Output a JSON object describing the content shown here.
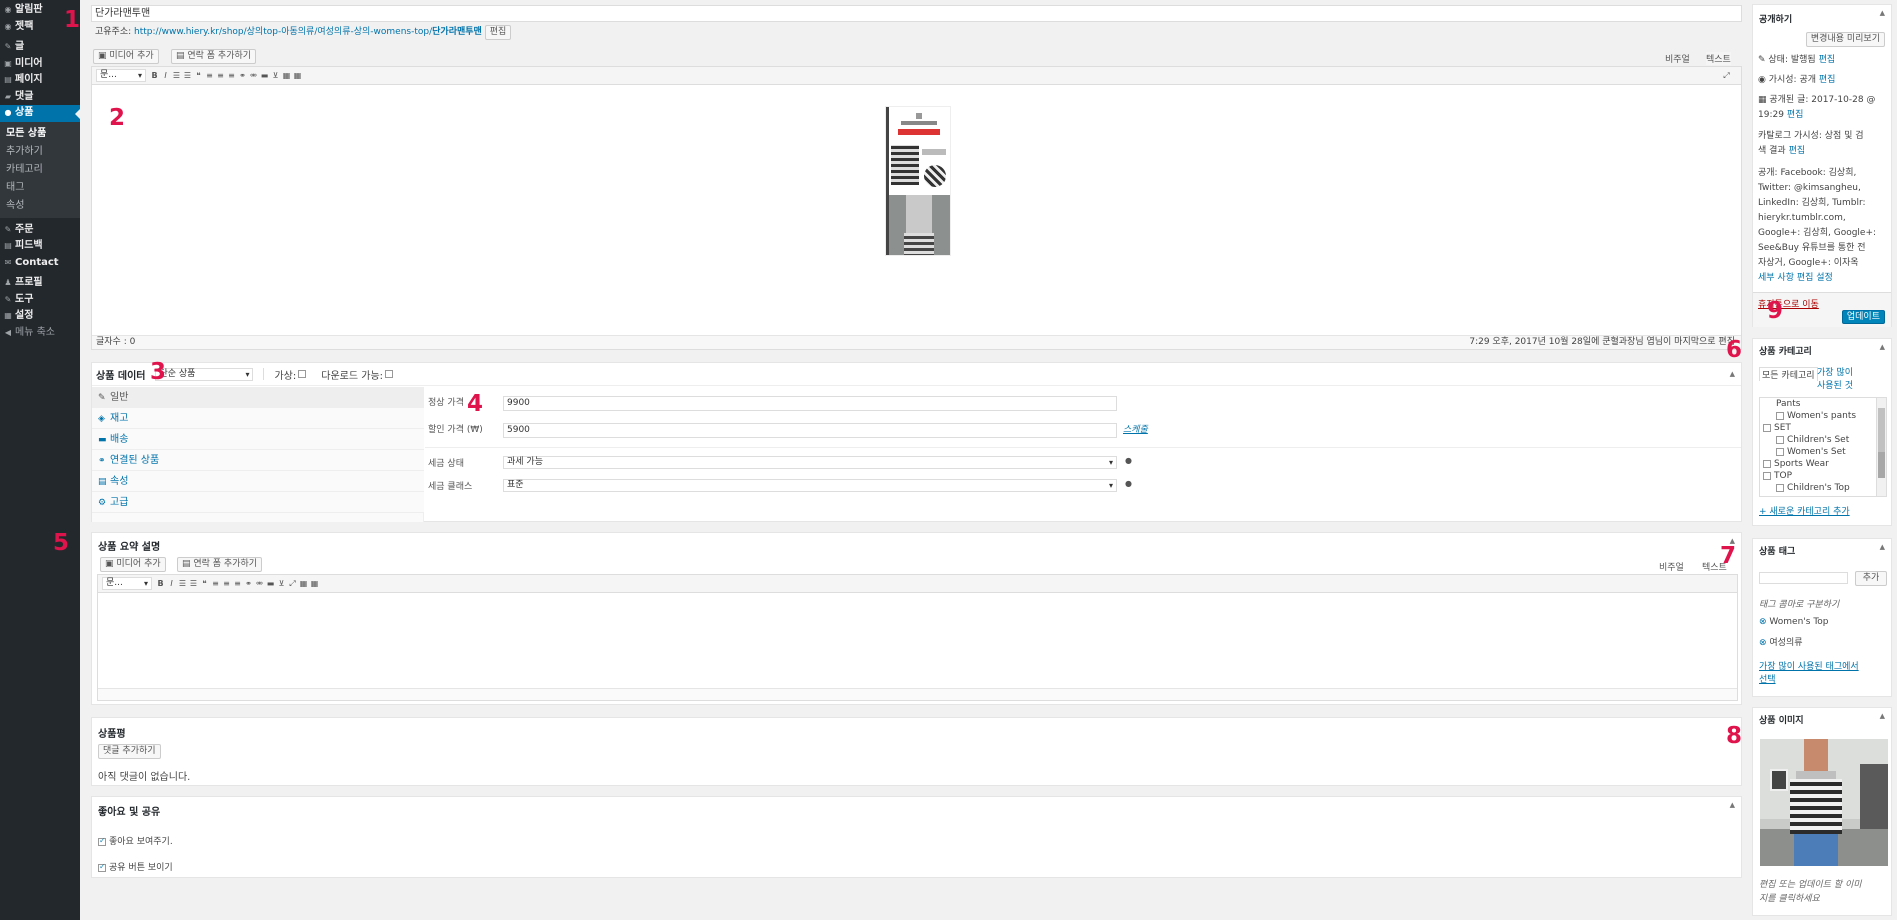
{
  "sidebar": {
    "items": [
      {
        "icon": "dashboard-icon",
        "label": "알림판"
      },
      {
        "icon": "jetpack-icon",
        "label": "젯팩"
      },
      {
        "icon": "pin-icon",
        "label": "글"
      },
      {
        "icon": "media-icon",
        "label": "미디어"
      },
      {
        "icon": "page-icon",
        "label": "페이지"
      },
      {
        "icon": "comment-icon",
        "label": "댓글"
      },
      {
        "icon": "product-icon",
        "label": "상품"
      }
    ],
    "sub": [
      "모든 상품",
      "추가하기",
      "카테고리",
      "태그",
      "속성"
    ],
    "items2": [
      {
        "icon": "pin-icon",
        "label": "주문"
      },
      {
        "icon": "feedback-icon",
        "label": "피드백"
      },
      {
        "icon": "mail-icon",
        "label": "Contact"
      },
      {
        "icon": "user-icon",
        "label": "프로필"
      },
      {
        "icon": "wrench-icon",
        "label": "도구"
      },
      {
        "icon": "settings-icon",
        "label": "설정"
      },
      {
        "icon": "collapse-icon",
        "label": "메뉴 축소"
      }
    ]
  },
  "editor": {
    "title": "단가라맨투맨",
    "permalink_label": "고유주소:",
    "permalink_url": "http://www.hiery.kr/shop/상의top-아동의류/여성의류-상의-womens-top/",
    "permalink_slug": "단가라맨투맨",
    "permalink_edit": "편집",
    "add_media": "미디어 추가",
    "add_contact": "연락 폼 추가하기",
    "tab_visual": "비주얼",
    "tab_text": "텍스트",
    "format_select": "문...",
    "word_count": "글자수 : 0",
    "last_edited": "7:29 오후, 2017년 10월 28일에 쿤혈과장님 엽님이 마지막으로 편집"
  },
  "product_data": {
    "heading": "상품 데이터",
    "type": "단순 상품",
    "virtual_label": "가상:",
    "download_label": "다운로드 가능:",
    "tabs": [
      {
        "icon": "wrench-icon",
        "label": "일반"
      },
      {
        "icon": "tag-icon",
        "label": "재고"
      },
      {
        "icon": "truck-icon",
        "label": "배송"
      },
      {
        "icon": "link-icon",
        "label": "연결된 상품"
      },
      {
        "icon": "list-icon",
        "label": "속성"
      },
      {
        "icon": "gear-icon",
        "label": "고급"
      }
    ],
    "regular_price_label": "정상 가격",
    "regular_price": "9900",
    "sale_price_label": "할인 가격 (₩)",
    "sale_price": "5900",
    "schedule": "스케줄",
    "tax_status_label": "세금 상태",
    "tax_status": "과세 가능",
    "tax_class_label": "세금 클래스",
    "tax_class": "표준"
  },
  "short_desc": {
    "heading": "상품 요약 설명",
    "add_media": "미디어 추가",
    "add_contact": "연락 폼 추가하기",
    "tab_visual": "비주얼",
    "tab_text": "텍스트",
    "format_select": "문..."
  },
  "reviews": {
    "heading": "상품평",
    "add_button": "댓글 추가하기",
    "empty": "아직 댓글이 없습니다."
  },
  "likes": {
    "heading": "좋아요 및 공유",
    "opt1": "좋아요 보여주기.",
    "opt2": "공유 버튼 보이기"
  },
  "publish": {
    "heading": "공개하기",
    "preview": "변경내용 미리보기",
    "status": "상태: 발행됨",
    "visibility": "가시성: 공개",
    "published_on_1": "공개된 글: 2017-10-28 @",
    "published_on_2": "19:29",
    "catalog_1": "카탈로그 가시성: 상점 및 검",
    "catalog_2": "색 결과",
    "edit": "편집",
    "share_1": "공개: Facebook: 김상희,",
    "share_2": "Twitter: @kimsangheu,",
    "share_3": "LinkedIn: 김상희, Tumblr:",
    "share_4": "hierykr.tumblr.com,",
    "share_5": "Google+: 김상희, Google+:",
    "share_6": "See&Buy 유튜브를 통한 전",
    "share_7": "자상거, Google+: 이자옥",
    "share_settings": "세부 사항 편집 설정",
    "trash": "휴지통으로 이동",
    "update": "업데이트"
  },
  "categories": {
    "heading": "상품 카테고리",
    "tab_all": "모든 카테고리",
    "tab_popular_1": "가장 많이",
    "tab_popular_2": "사용된 것",
    "items": [
      {
        "label": "Pants",
        "level": 1,
        "check": false
      },
      {
        "label": "Women's pants",
        "level": 2,
        "check": true
      },
      {
        "label": "SET",
        "level": 1,
        "check": true
      },
      {
        "label": "Children's Set",
        "level": 2,
        "check": true
      },
      {
        "label": "Women's Set",
        "level": 2,
        "check": true
      },
      {
        "label": "Sports Wear",
        "level": 1,
        "check": true
      },
      {
        "label": "TOP",
        "level": 1,
        "check": true
      },
      {
        "label": "Children's Top",
        "level": 2,
        "check": true
      }
    ],
    "add_new": "+ 새로운 카테고리 추가"
  },
  "tags": {
    "heading": "상품 태그",
    "add_button": "추가",
    "hint": "태그 콤마로 구분하기",
    "items": [
      "Women's Top",
      "여성의류"
    ],
    "popular_1": "가장 많이 사용된 태그에서",
    "popular_2": "선택"
  },
  "product_image": {
    "heading": "상품 이미지",
    "hint_1": "편집 또는 업데이트 할 이미",
    "hint_2": "지를 클릭하세요"
  },
  "markers": [
    "1",
    "2",
    "3",
    "4",
    "5",
    "6",
    "7",
    "8",
    "9"
  ]
}
